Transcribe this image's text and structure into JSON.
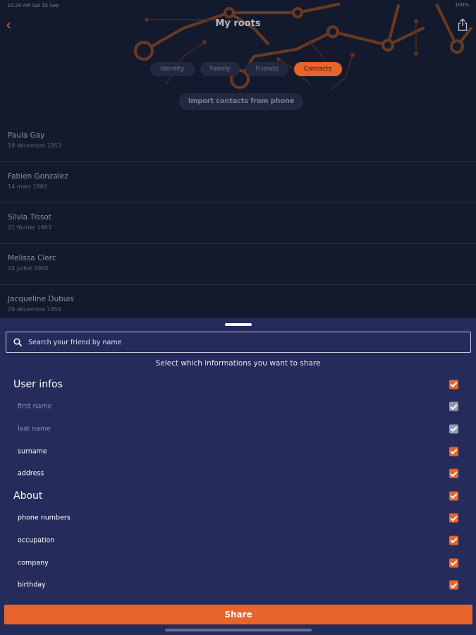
{
  "status": {
    "left": "10:24 AM Sat 15 Sep",
    "right": "100%"
  },
  "header": {
    "title": "My roots",
    "tabs": [
      {
        "label": "Identity",
        "active": false
      },
      {
        "label": "Family",
        "active": false
      },
      {
        "label": "Friends",
        "active": false
      },
      {
        "label": "Contacts",
        "active": true
      }
    ],
    "import_label": "Import contacts from phone"
  },
  "contacts": [
    {
      "name": "Paula Gay",
      "date": "19 décembre 1953"
    },
    {
      "name": "Fabien Gonzalez",
      "date": "14 mars 1960"
    },
    {
      "name": "Silvia Tissot",
      "date": "21 février 1983"
    },
    {
      "name": "Melissa Clerc",
      "date": "24 juillet 1995"
    },
    {
      "name": "Jacqueline Dubuis",
      "date": "29 décembre 1954"
    }
  ],
  "sheet": {
    "search_placeholder": "Search your friend by name",
    "hint": "Select which informations you want to share",
    "options": [
      {
        "label": "User infos",
        "type": "section",
        "checked": true,
        "disabled": false
      },
      {
        "label": "first name",
        "type": "item",
        "checked": true,
        "disabled": true
      },
      {
        "label": "last name",
        "type": "item",
        "checked": true,
        "disabled": true
      },
      {
        "label": "surname",
        "type": "item",
        "checked": true,
        "disabled": false
      },
      {
        "label": "address",
        "type": "item",
        "checked": true,
        "disabled": false
      },
      {
        "label": "About",
        "type": "section",
        "checked": true,
        "disabled": false
      },
      {
        "label": "phone numbers",
        "type": "item",
        "checked": true,
        "disabled": false
      },
      {
        "label": "occupation",
        "type": "item",
        "checked": true,
        "disabled": false
      },
      {
        "label": "company",
        "type": "item",
        "checked": true,
        "disabled": false
      },
      {
        "label": "birthday",
        "type": "item",
        "checked": true,
        "disabled": false
      }
    ],
    "share_label": "Share"
  },
  "colors": {
    "accent": "#e8642a",
    "background": "#141a2e",
    "sheet": "#252b5a"
  }
}
